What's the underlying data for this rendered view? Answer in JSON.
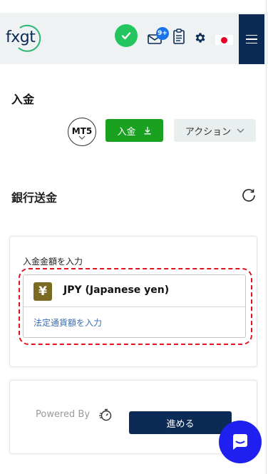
{
  "header": {
    "logo_text": "fxgt",
    "notification_badge": "9+",
    "brand_color": "#0b2a55",
    "status_color": "#22c55e",
    "icons": [
      "logo",
      "check-icon",
      "mail-icon",
      "clipboard-icon",
      "gear-icon",
      "japan-flag-icon",
      "hamburger-menu-icon"
    ]
  },
  "page": {
    "title": "入金"
  },
  "account": {
    "platform_label": "MT5"
  },
  "buttons": {
    "deposit_label": "入金",
    "action_label": "アクション",
    "deposit_color": "#1aa120"
  },
  "section": {
    "title": "銀行送金"
  },
  "deposit_form": {
    "amount_label": "入金金額を入力",
    "currency_symbol": "¥",
    "currency_name": "JPY (Japanese yen)",
    "amount_placeholder": "法定通貨額を入力",
    "highlight_color": "#e0141e"
  },
  "footer_card": {
    "powered_by": "Powered By",
    "proceed_label": "進める"
  },
  "chat": {
    "color": "#1f1ff0"
  }
}
